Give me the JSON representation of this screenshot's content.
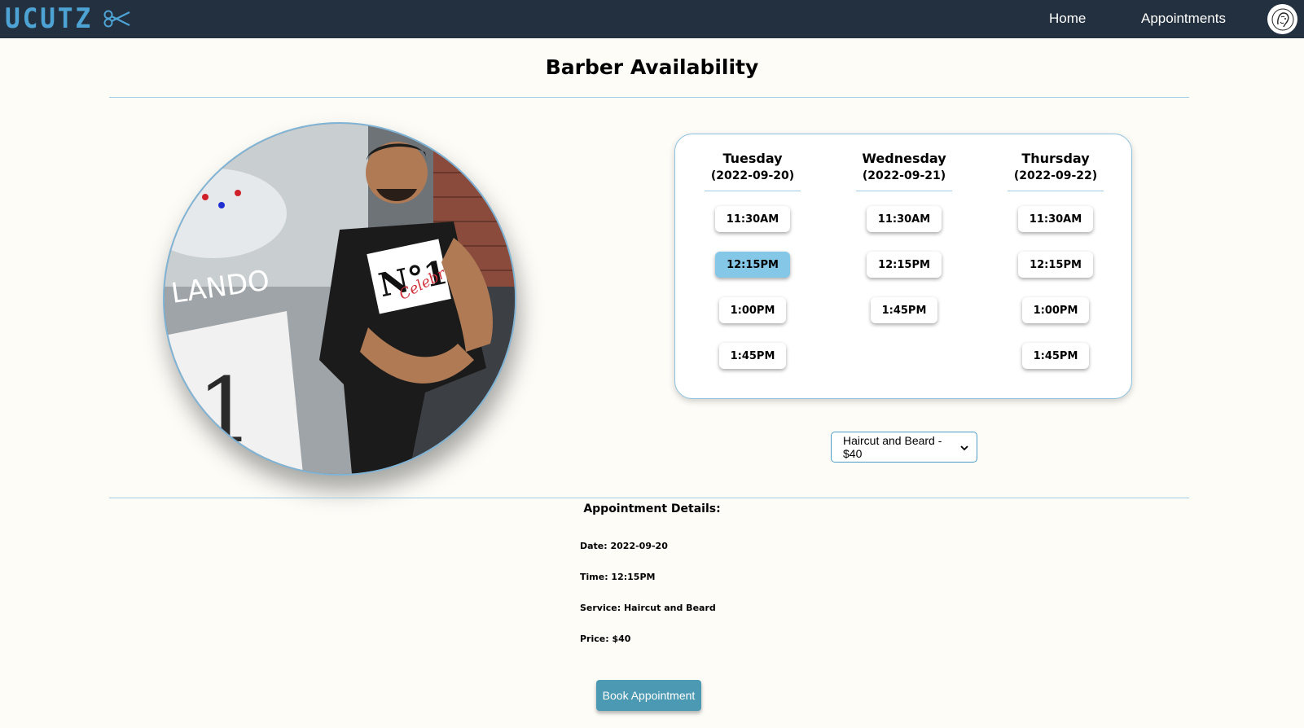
{
  "navbar": {
    "logo_text": "UCUTZ",
    "home_label": "Home",
    "appointments_label": "Appointments",
    "accent_color": "#4da3d4",
    "background": "#233040"
  },
  "page": {
    "title": "Barber Availability"
  },
  "availability": {
    "days": [
      {
        "name": "Tuesday",
        "date": "(2022-09-20)",
        "slots": [
          "11:30AM",
          "12:15PM",
          "1:00PM",
          "1:45PM"
        ]
      },
      {
        "name": "Wednesday",
        "date": "(2022-09-21)",
        "slots": [
          "11:30AM",
          "12:15PM",
          "1:45PM"
        ]
      },
      {
        "name": "Thursday",
        "date": "(2022-09-22)",
        "slots": [
          "11:30AM",
          "12:15PM",
          "1:00PM",
          "1:45PM"
        ]
      }
    ],
    "selected_slot": "12:15PM",
    "selected_day": "Tuesday",
    "selected_color": "#84c7e6"
  },
  "service_select": {
    "value": "Haircut and Beard - $40"
  },
  "details": {
    "title": "Appointment Details:",
    "date": "Date: 2022-09-20",
    "time": "Time: 12:15PM",
    "service": "Service: Haircut and Beard",
    "price": "Price: $40"
  },
  "book_button": {
    "label": "Book Appointment"
  }
}
